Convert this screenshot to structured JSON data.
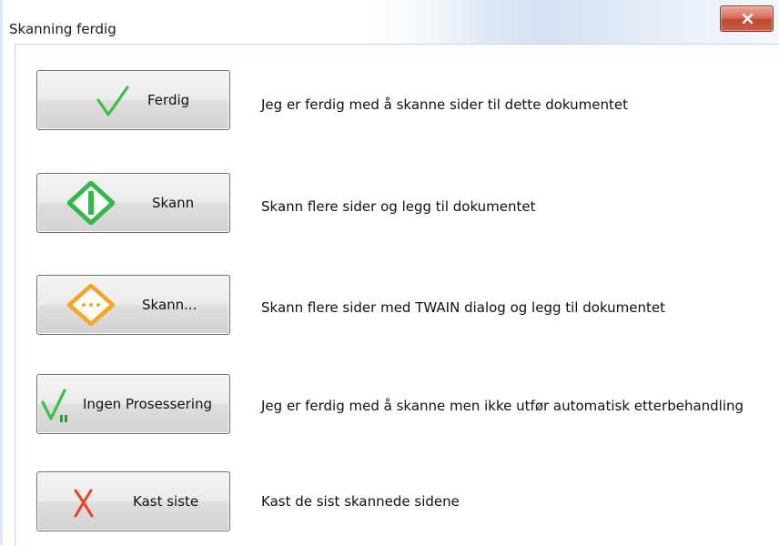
{
  "window": {
    "title": "Skanning ferdig"
  },
  "options": [
    {
      "label": "Ferdig",
      "icon": "checkmark-icon",
      "description": "Jeg er ferdig med å skanne sider til dette dokumentet"
    },
    {
      "label": "Skann",
      "icon": "scan-start-icon",
      "description": "Skann flere sider og legg til dokumentet"
    },
    {
      "label": "Skann...",
      "icon": "scan-dialog-icon",
      "description": "Skann flere sider med TWAIN dialog og legg til dokumentet"
    },
    {
      "label": "Ingen Prosessering",
      "icon": "checkmark-no-processing-icon",
      "description": "Jeg er ferdig med å skanne men ikke utfør automatisk etterbehandling"
    },
    {
      "label": "Kast siste",
      "icon": "discard-x-icon",
      "description": "Kast de sist skannede sidene"
    }
  ],
  "colors": {
    "check_green": "#3fbf4a",
    "scan_green": "#35b84a",
    "twain_orange": "#f5a623",
    "discard_red": "#e8442c",
    "close_red": "#c24a35"
  }
}
